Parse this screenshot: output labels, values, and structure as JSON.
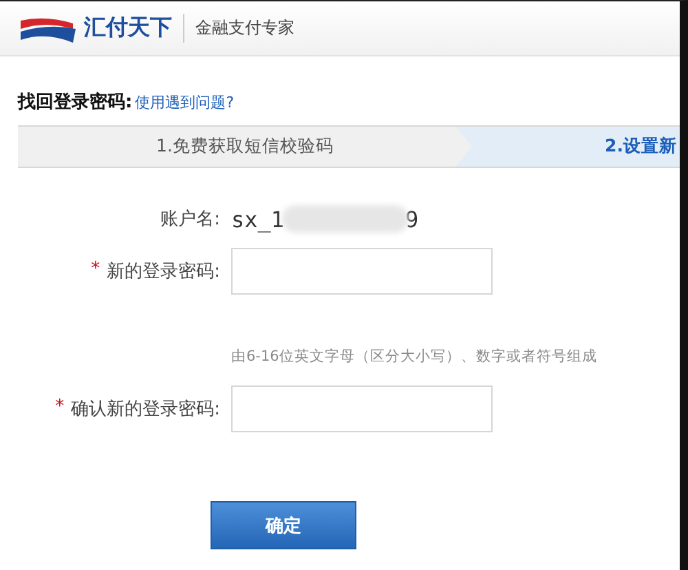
{
  "header": {
    "brand": "汇付天下",
    "slogan": "金融支付专家"
  },
  "title": "找回登录密码:",
  "help_link": "使用遇到问题?",
  "steps": [
    {
      "label": "1.免费获取短信校验码",
      "selected": false
    },
    {
      "label": "2.设置新",
      "selected": true
    }
  ],
  "account": {
    "label": "账户名:",
    "value_start": "sx_1",
    "value_end": "9"
  },
  "fields": [
    {
      "label": "新的登录密码:",
      "marker": "*",
      "hint": "由6-16位英文字母（区分大小写）、数字或者符号组成"
    },
    {
      "label": "确认新的登录密码:",
      "marker": "*"
    }
  ],
  "submit": "确定"
}
